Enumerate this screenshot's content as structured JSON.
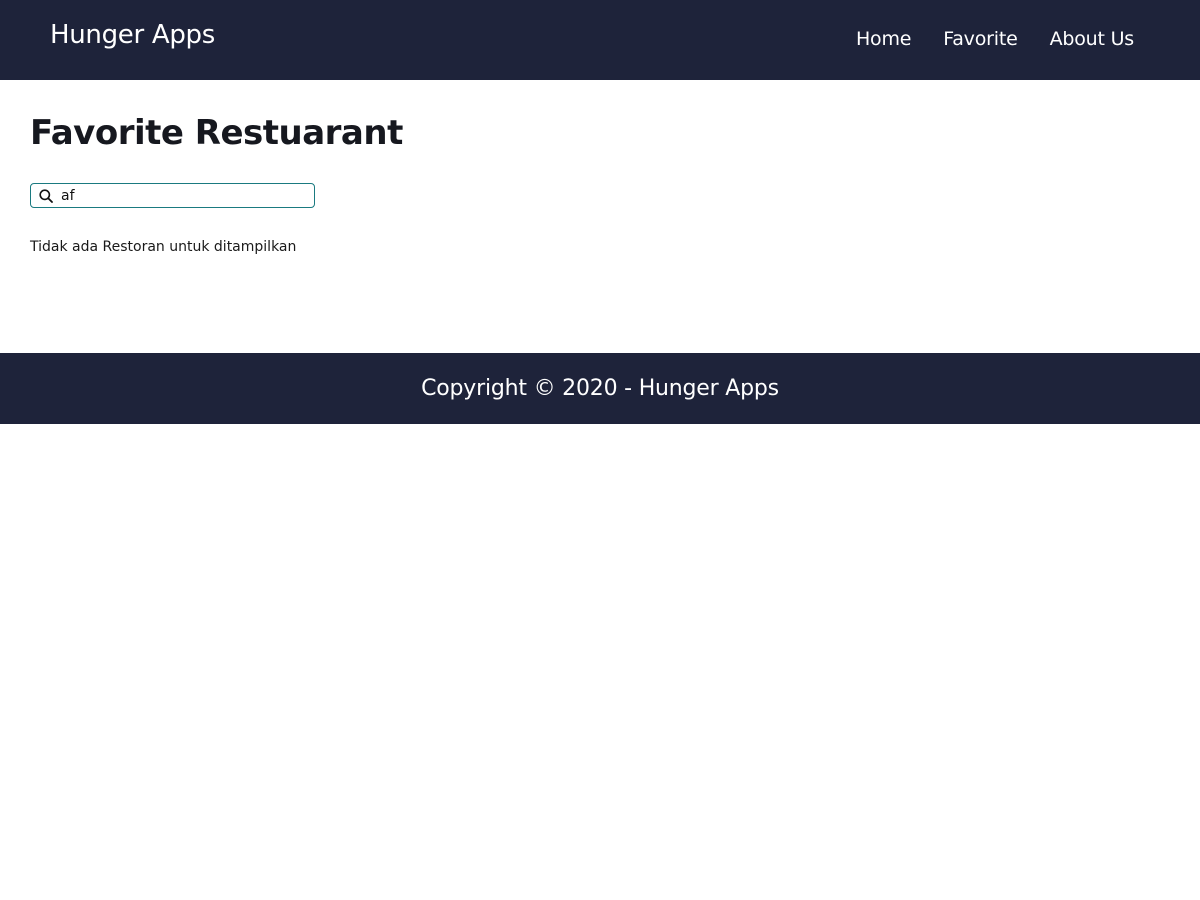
{
  "header": {
    "brand": "Hunger Apps",
    "nav": [
      {
        "label": "Home"
      },
      {
        "label": "Favorite"
      },
      {
        "label": "About Us"
      }
    ]
  },
  "main": {
    "title": "Favorite Restuarant",
    "search": {
      "value": "af",
      "icon": "search-icon"
    },
    "empty_message": "Tidak ada Restoran untuk ditampilkan"
  },
  "footer": {
    "copyright": "Copyright © 2020 - Hunger Apps"
  },
  "colors": {
    "header_bg": "#1e233a",
    "footer_bg": "#1e233a",
    "search_border": "#1a7a80"
  }
}
